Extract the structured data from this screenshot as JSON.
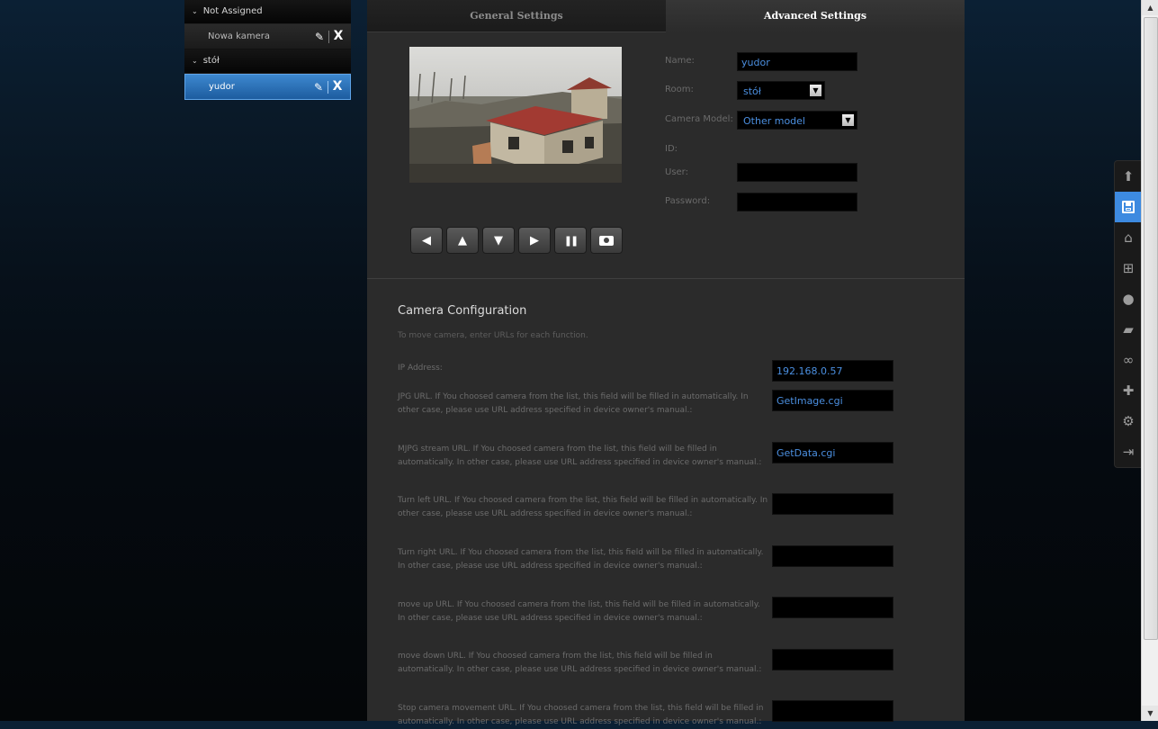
{
  "tree": {
    "groups": [
      {
        "label": "Not Assigned",
        "items": [
          {
            "label": "Nowa kamera"
          }
        ]
      },
      {
        "label": "stół",
        "items": [
          {
            "label": "yudor"
          }
        ]
      }
    ],
    "edit_glyph": "✎",
    "delete_glyph": "X"
  },
  "tabs": {
    "general": "General Settings",
    "advanced": "Advanced Settings"
  },
  "controls": {
    "left_icon": "◀",
    "up_icon": "▲",
    "down_icon": "▼",
    "right_icon": "▶",
    "pause_icon": "❚❚",
    "snapshot_icon": "📷"
  },
  "form": {
    "name_label": "Name:",
    "name_value": "yudor",
    "room_label": "Room:",
    "room_value": "stół",
    "model_label": "Camera Model:",
    "model_value": "Other model",
    "id_label": "ID:",
    "user_label": "User:",
    "user_value": "",
    "password_label": "Password:",
    "password_value": ""
  },
  "config": {
    "title": "Camera Configuration",
    "subtitle": "To move camera, enter URLs for each function.",
    "rows": [
      {
        "label": "IP Address:",
        "value": "192.168.0.57"
      },
      {
        "label": "JPG URL. If You choosed camera from the list, this field will be filled in automatically. In other case, please use URL address specified in device owner's manual.:",
        "value": "GetImage.cgi"
      },
      {
        "label": "MJPG stream URL. If You choosed camera from the list, this field will be filled in automatically. In other case, please use URL address specified in device owner's manual.:",
        "value": "GetData.cgi"
      },
      {
        "label": "Turn left URL. If You choosed camera from the list, this field will be filled in automatically. In other case, please use URL address specified in device owner's manual.:",
        "value": ""
      },
      {
        "label": "Turn right URL. If You choosed camera from the list, this field will be filled in automatically. In other case, please use URL address specified in device owner's manual.:",
        "value": ""
      },
      {
        "label": "move up URL. If You choosed camera from the list, this field will be filled in automatically. In other case, please use URL address specified in device owner's manual.:",
        "value": ""
      },
      {
        "label": "move down URL. If You choosed camera from the list, this field will be filled in automatically. In other case, please use URL address specified in device owner's manual.:",
        "value": ""
      },
      {
        "label": "Stop camera movement URL. If You choosed camera from the list, this field will be filled in automatically. In other case, please use URL address specified in device owner's manual.:",
        "value": ""
      }
    ]
  },
  "toolbar": {
    "icons": [
      "up-arrow-icon",
      "save-icon",
      "home-icon",
      "network-icon",
      "bulb-icon",
      "clapper-icon",
      "link-icon",
      "plugin-icon",
      "settings-icon",
      "logout-icon"
    ],
    "active": "save-icon"
  },
  "colors": {
    "accent": "#3d8ae0",
    "input_text": "#4b8fe0",
    "panel_bg": "#2b2b2b"
  }
}
